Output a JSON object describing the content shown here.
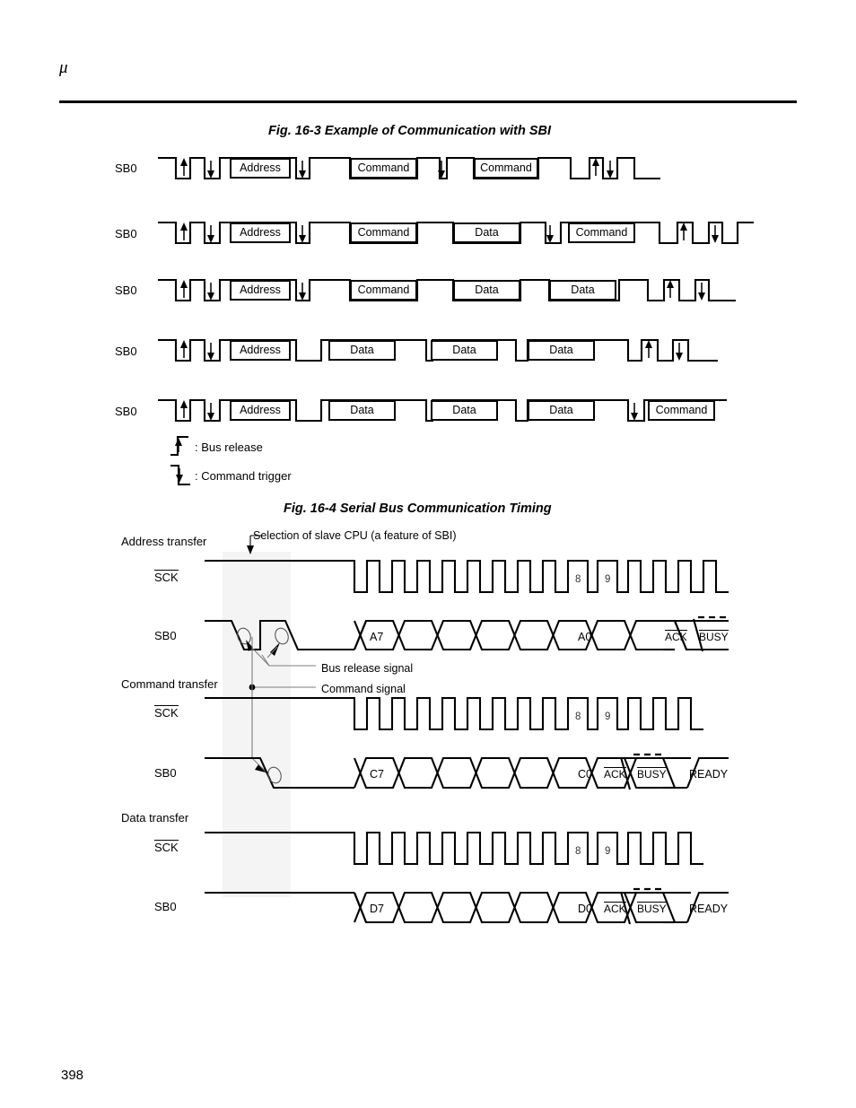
{
  "header": {
    "mu_symbol": "μ"
  },
  "page_number": "398",
  "figures": [
    {
      "id": "fig-16-3",
      "title": "Fig. 16-3  Example of Communication with SBI",
      "rows": [
        {
          "label": "SB0",
          "cells": [
            "Address",
            "Command",
            "Command"
          ]
        },
        {
          "label": "SB0",
          "cells": [
            "Address",
            "Command",
            "Data",
            "Command"
          ]
        },
        {
          "label": "SB0",
          "cells": [
            "Address",
            "Command",
            "Data",
            "Data"
          ]
        },
        {
          "label": "SB0",
          "cells": [
            "Address",
            "Data",
            "Data",
            "Data"
          ]
        },
        {
          "label": "SB0",
          "cells": [
            "Address",
            "Data",
            "Data",
            "Data",
            "Command"
          ]
        }
      ],
      "legend": [
        {
          "symbol": "rising-edge-arrow",
          "text": ": Bus release"
        },
        {
          "symbol": "falling-edge-arrow",
          "text": ": Command trigger"
        }
      ]
    },
    {
      "id": "fig-16-4",
      "title": "Fig. 16-4  Serial Bus Communication Timing",
      "callout": "Selection of slave CPU (a feature of SBI)",
      "annotations": [
        "Bus release signal",
        "Command signal"
      ],
      "sections": [
        {
          "name": "Address transfer",
          "clock_label": "SCK",
          "data_label": "SB0",
          "clock_numbers": [
            "8",
            "9"
          ],
          "first_bit": "A7",
          "last_bit": "A0",
          "ack_label": "ACK",
          "busy_label": "BUSY",
          "ready_label": ""
        },
        {
          "name": "Command transfer",
          "clock_label": "SCK",
          "data_label": "SB0",
          "clock_numbers": [
            "8",
            "9"
          ],
          "first_bit": "C7",
          "last_bit": "C0",
          "ack_label": "ACK",
          "busy_label": "BUSY",
          "ready_label": "READY"
        },
        {
          "name": "Data transfer",
          "clock_label": "SCK",
          "data_label": "SB0",
          "clock_numbers": [
            "8",
            "9"
          ],
          "first_bit": "D7",
          "last_bit": "D0",
          "ack_label": "ACK",
          "busy_label": "BUSY",
          "ready_label": "READY"
        }
      ]
    }
  ],
  "colors": {
    "ink": "#000000",
    "lead_line": "#7d7d7d",
    "highlight_band": "#f4f4f4"
  }
}
